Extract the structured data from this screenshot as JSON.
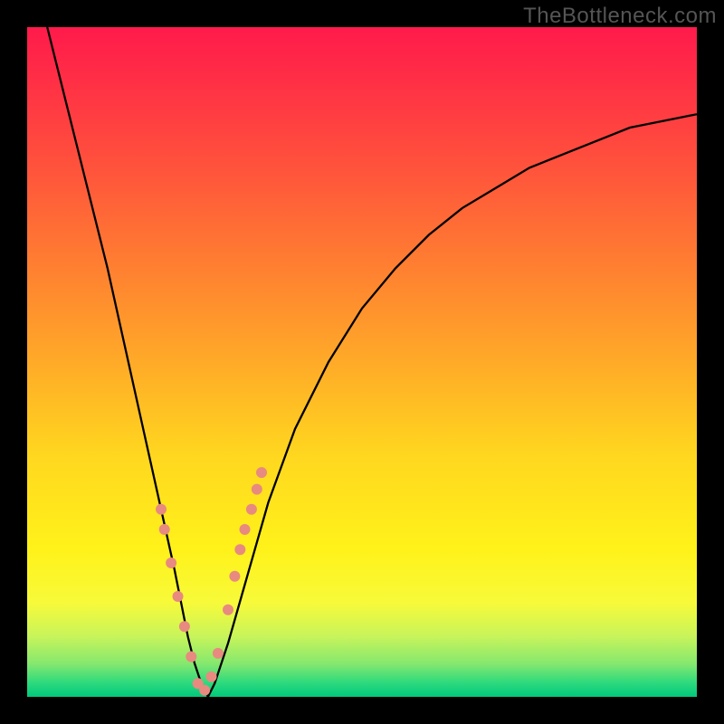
{
  "watermark": "TheBottleneck.com",
  "chart_data": {
    "type": "line",
    "title": "",
    "xlabel": "",
    "ylabel": "",
    "xlim": [
      0,
      100
    ],
    "ylim": [
      0,
      100
    ],
    "grid": false,
    "legend": false,
    "series": [
      {
        "name": "bottleneck-curve",
        "color": "#000000",
        "x": [
          3,
          5,
          8,
          10,
          12,
          14,
          16,
          18,
          20,
          22,
          23,
          24,
          25,
          26,
          27,
          28,
          30,
          32,
          34,
          36,
          40,
          45,
          50,
          55,
          60,
          65,
          70,
          75,
          80,
          85,
          90,
          95,
          100
        ],
        "values": [
          100,
          92,
          80,
          72,
          64,
          55,
          46,
          37,
          28,
          19,
          14,
          9,
          5,
          2,
          0,
          2,
          8,
          15,
          22,
          29,
          40,
          50,
          58,
          64,
          69,
          73,
          76,
          79,
          81,
          83,
          85,
          86,
          87
        ]
      }
    ],
    "markers": {
      "name": "highlight-dots",
      "color": "#e88a80",
      "radius": 6,
      "x": [
        20.0,
        20.5,
        21.5,
        22.5,
        23.5,
        24.5,
        25.5,
        26.5,
        27.5,
        28.5,
        30.0,
        31.0,
        31.8,
        32.5,
        33.5,
        34.3,
        35.0
      ],
      "values": [
        28.0,
        25.0,
        20.0,
        15.0,
        10.5,
        6.0,
        2.0,
        1.0,
        3.0,
        6.5,
        13.0,
        18.0,
        22.0,
        25.0,
        28.0,
        31.0,
        33.5
      ]
    }
  }
}
